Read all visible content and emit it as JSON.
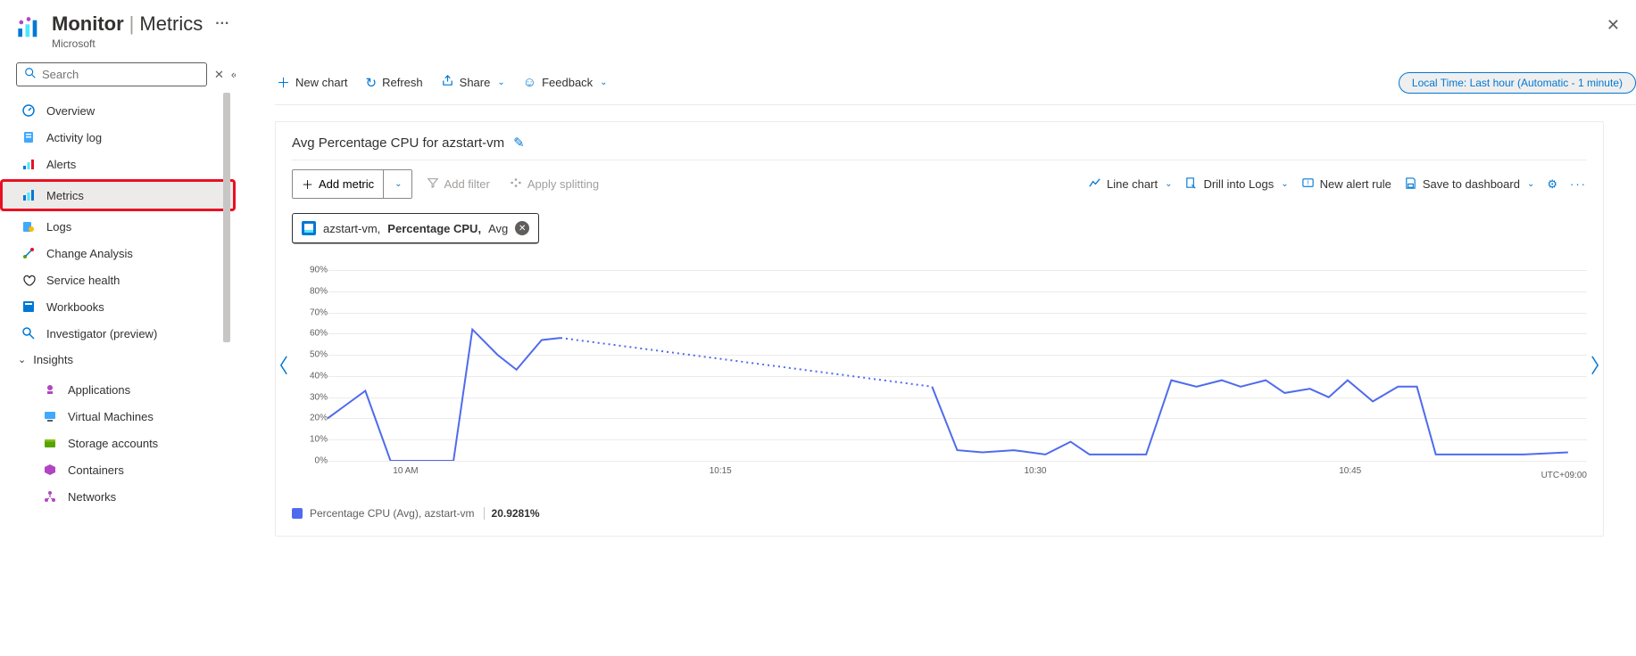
{
  "header": {
    "title_main": "Monitor",
    "title_sep": "|",
    "title_sub": "Metrics",
    "dots": "···",
    "subtitle": "Microsoft"
  },
  "search": {
    "placeholder": "Search"
  },
  "sidebar": {
    "items": [
      {
        "label": "Overview",
        "icon": "overview"
      },
      {
        "label": "Activity log",
        "icon": "log"
      },
      {
        "label": "Alerts",
        "icon": "alerts"
      },
      {
        "label": "Metrics",
        "icon": "metrics",
        "active": true,
        "highlight": true
      },
      {
        "label": "Logs",
        "icon": "logs"
      },
      {
        "label": "Change Analysis",
        "icon": "change"
      },
      {
        "label": "Service health",
        "icon": "health"
      },
      {
        "label": "Workbooks",
        "icon": "workbooks"
      },
      {
        "label": "Investigator (preview)",
        "icon": "investigator"
      }
    ],
    "group": {
      "label": "Insights"
    },
    "sub_items": [
      {
        "label": "Applications",
        "icon": "apps"
      },
      {
        "label": "Virtual Machines",
        "icon": "vms"
      },
      {
        "label": "Storage accounts",
        "icon": "storage"
      },
      {
        "label": "Containers",
        "icon": "containers"
      },
      {
        "label": "Networks",
        "icon": "networks"
      }
    ]
  },
  "toolbar": {
    "new_chart": "New chart",
    "refresh": "Refresh",
    "share": "Share",
    "feedback": "Feedback",
    "time_pill": "Local Time: Last hour (Automatic - 1 minute)"
  },
  "chart": {
    "title": "Avg Percentage CPU for azstart-vm",
    "add_metric": "Add metric",
    "add_filter": "Add filter",
    "apply_splitting": "Apply splitting",
    "line_chart": "Line chart",
    "drill_logs": "Drill into Logs",
    "new_alert": "New alert rule",
    "save_dashboard": "Save to dashboard",
    "pill_resource": "azstart-vm,",
    "pill_metric": "Percentage CPU,",
    "pill_agg": "Avg",
    "legend_name": "Percentage CPU (Avg), azstart-vm",
    "legend_value": "20.9281%",
    "tz": "UTC+09:00"
  },
  "chart_data": {
    "type": "line",
    "title": "Avg Percentage CPU for azstart-vm",
    "xlabel": "",
    "ylabel": "",
    "ylim": [
      0,
      90
    ],
    "y_ticks": [
      "0%",
      "10%",
      "20%",
      "30%",
      "40%",
      "50%",
      "60%",
      "70%",
      "80%",
      "90%"
    ],
    "x_ticks": [
      "10 AM",
      "10:15",
      "10:30",
      "10:45"
    ],
    "x_tick_positions": [
      0.062,
      0.312,
      0.562,
      0.812
    ],
    "series": [
      {
        "name": "Percentage CPU (Avg), azstart-vm",
        "color": "#4f6bed",
        "segments": [
          {
            "style": "solid",
            "points": [
              [
                0.0,
                20
              ],
              [
                0.03,
                33
              ],
              [
                0.05,
                0
              ],
              [
                0.08,
                0
              ],
              [
                0.1,
                0
              ],
              [
                0.115,
                62
              ],
              [
                0.135,
                50
              ],
              [
                0.15,
                43
              ],
              [
                0.17,
                57
              ],
              [
                0.185,
                58
              ]
            ]
          },
          {
            "style": "dotted",
            "points": [
              [
                0.185,
                58
              ],
              [
                0.48,
                35
              ]
            ]
          },
          {
            "style": "solid",
            "points": [
              [
                0.48,
                35
              ],
              [
                0.5,
                5
              ],
              [
                0.52,
                4
              ],
              [
                0.545,
                5
              ],
              [
                0.57,
                3
              ],
              [
                0.59,
                9
              ],
              [
                0.605,
                3
              ],
              [
                0.63,
                3
              ],
              [
                0.65,
                3
              ],
              [
                0.67,
                38
              ],
              [
                0.69,
                35
              ],
              [
                0.71,
                38
              ],
              [
                0.725,
                35
              ],
              [
                0.745,
                38
              ],
              [
                0.76,
                32
              ],
              [
                0.78,
                34
              ],
              [
                0.795,
                30
              ],
              [
                0.81,
                38
              ],
              [
                0.83,
                28
              ],
              [
                0.85,
                35
              ],
              [
                0.865,
                35
              ],
              [
                0.88,
                3
              ],
              [
                0.91,
                3
              ],
              [
                0.95,
                3
              ],
              [
                0.985,
                4
              ]
            ]
          }
        ]
      }
    ]
  }
}
